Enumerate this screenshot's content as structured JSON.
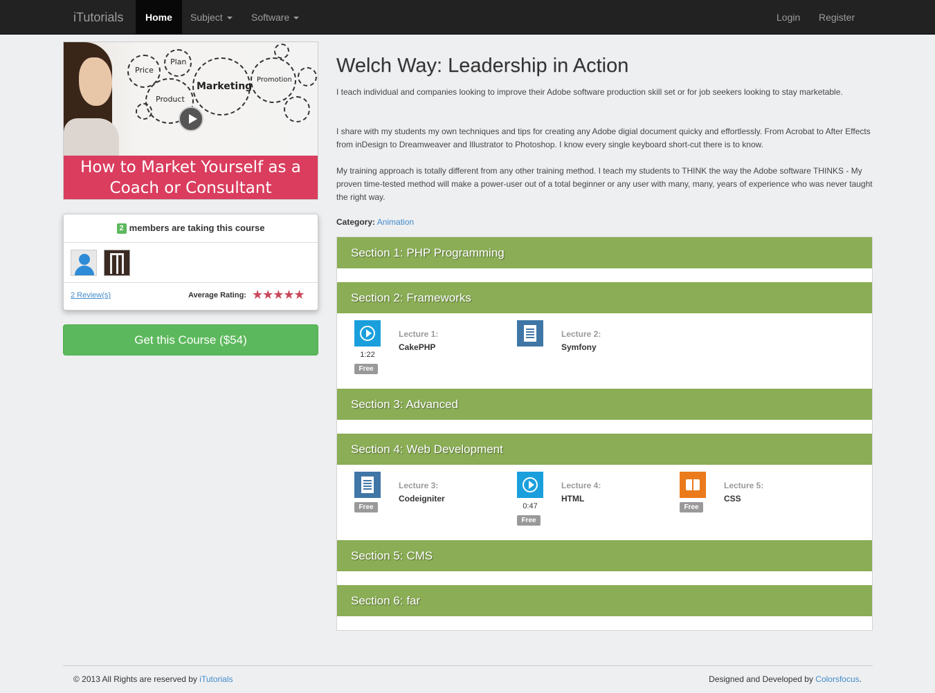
{
  "nav": {
    "brand": "iTutorials",
    "home": "Home",
    "subject": "Subject",
    "software": "Software",
    "login": "Login",
    "register": "Register"
  },
  "video": {
    "banner_line1": "How to Market Yourself as a",
    "banner_line2": "Coach or Consultant",
    "words": [
      "Price",
      "Plan",
      "Marketing",
      "Promotion",
      "Product"
    ]
  },
  "members": {
    "count": "2",
    "label": "members are taking this course",
    "reviews": "2 Review(s)",
    "avg_label": "Average Rating:",
    "rating": 5,
    "stars": "★★★★★"
  },
  "buy_button": "Get this Course ($54)",
  "course": {
    "title": "Welch Way: Leadership in Action",
    "paragraphs": [
      "I teach individual and companies looking to improve their Adobe software production skill set or for job seekers looking to stay marketable.",
      "I share with my students my own techniques and tips for creating any Adobe digial document quicky and effortlessly. From Acrobat to After Effects from inDesign to Dreamweaver and Illustrator to Photoshop. I know every single keyboard short-cut there is to know.",
      "My training approach is totally different from any other training method. I teach my students to THINK the way the Adobe software THINKS - My proven time-tested method will make a power-user out of a total beginner or any user with many, many, years of experience who was never taught the right way."
    ],
    "category_label": "Category:",
    "category": "Animation"
  },
  "sections": [
    {
      "title": "Section 1: PHP Programming"
    },
    {
      "title": "Section 2: Frameworks"
    },
    {
      "title": "Section 3: Advanced"
    },
    {
      "title": "Section 4: Web Development"
    },
    {
      "title": "Section 5: CMS"
    },
    {
      "title": "Section 6: far"
    }
  ],
  "lectures": [
    {
      "num": "Lecture 1:",
      "name": "CakePHP",
      "icon": "video-icon",
      "duration": "1:22",
      "free": "Free"
    },
    {
      "num": "Lecture 2:",
      "name": "Symfony",
      "icon": "document-icon"
    },
    {
      "num": "Lecture 3:",
      "name": "Codeigniter",
      "icon": "document-icon",
      "free": "Free"
    },
    {
      "num": "Lecture 4:",
      "name": "HTML",
      "icon": "video-icon",
      "duration": "0:47",
      "free": "Free"
    },
    {
      "num": "Lecture 5:",
      "name": "CSS",
      "icon": "book-icon",
      "free": "Free"
    }
  ],
  "footer": {
    "copyright": "© 2013 All Rights are reserved by",
    "copyright_link": "iTutorials",
    "designed": "Designed and Developed by",
    "designed_link": "Colorsfocus",
    "designed_suffix": "."
  },
  "colors": {
    "navbar": "#222222",
    "section_header": "#8aad55",
    "buy_button": "#5cb85c",
    "banner": "#da3d5e",
    "link": "#428bca"
  }
}
